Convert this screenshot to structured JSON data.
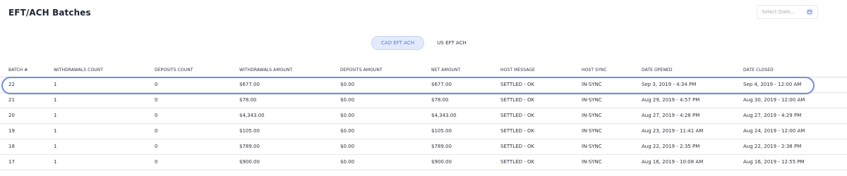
{
  "header": {
    "title": "EFT/ACH Batches",
    "date_placeholder": "Select Date...",
    "calendar_icon": "calendar-icon"
  },
  "tabs": [
    {
      "label": "CAD EFT ACH",
      "active": true
    },
    {
      "label": "US EFT ACH",
      "active": false
    }
  ],
  "colors": {
    "accent": "#5b78d6",
    "active_tab_bg": "#e3eafc",
    "highlight_ring": "#6f8fe0"
  },
  "table": {
    "columns": [
      "BATCH #",
      "WITHDRAWALS COUNT",
      "DEPOSITS COUNT",
      "WITHDRAWALS AMOUNT",
      "DEPOSITS AMOUNT",
      "NET AMOUNT",
      "HOST MESSAGE",
      "HOST SYNC",
      "DATE OPENED",
      "DATE CLOSED"
    ],
    "rows": [
      [
        "22",
        "1",
        "0",
        "$677.00",
        "$0.00",
        "$677.00",
        "SETTLED - OK",
        "IN-SYNC",
        "Sep 3, 2019 - 4:34 PM",
        "Sep 4, 2019 - 12:00 AM"
      ],
      [
        "21",
        "1",
        "0",
        "$78.00",
        "$0.00",
        "$78.00",
        "SETTLED - OK",
        "IN-SYNC",
        "Aug 29, 2019 - 4:57 PM",
        "Aug 30, 2019 - 12:00 AM"
      ],
      [
        "20",
        "1",
        "0",
        "$4,343.00",
        "$0.00",
        "$4,343.00",
        "SETTLED - OK",
        "IN-SYNC",
        "Aug 27, 2019 - 4:28 PM",
        "Aug 27, 2019 - 4:29 PM"
      ],
      [
        "19",
        "1",
        "0",
        "$105.00",
        "$0.00",
        "$105.00",
        "SETTLED - OK",
        "IN-SYNC",
        "Aug 23, 2019 - 11:41 AM",
        "Aug 24, 2019 - 12:00 AM"
      ],
      [
        "18",
        "1",
        "0",
        "$789.00",
        "$0.00",
        "$789.00",
        "SETTLED - OK",
        "IN-SYNC",
        "Aug 22, 2019 - 2:35 PM",
        "Aug 22, 2019 - 2:38 PM"
      ],
      [
        "17",
        "1",
        "0",
        "$900.00",
        "$0.00",
        "$900.00",
        "SETTLED - OK",
        "IN-SYNC",
        "Aug 16, 2019 - 10:08 AM",
        "Aug 16, 2019 - 12:55 PM"
      ]
    ]
  }
}
